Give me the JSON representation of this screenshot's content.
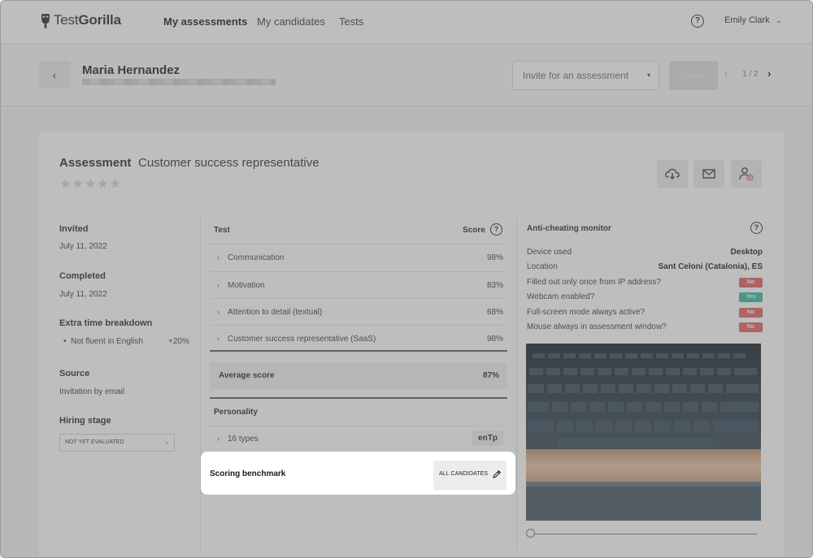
{
  "nav": {
    "logo_prefix": "Test",
    "logo_bold": "Gorilla",
    "links": [
      "My assessments",
      "My candidates",
      "Tests"
    ],
    "help": "?",
    "user_name": "Emily Clark",
    "user_chevron": "⌄"
  },
  "candidate": {
    "back": "‹",
    "name": "Maria Hernandez",
    "invite_placeholder": "Invite for an assessment",
    "invite_caret": "▾",
    "invite_button": "Invite",
    "pager": "1 / 2",
    "prev": "‹",
    "next": "›"
  },
  "assessment": {
    "label": "Assessment",
    "name": "Customer success representative",
    "stars": "★★★★★",
    "rating": 0,
    "actions": [
      "download-cloud-icon",
      "mail-icon",
      "remove-user-icon"
    ]
  },
  "side": {
    "invited_label": "Invited",
    "invited_value": "July 11, 2022",
    "completed_label": "Completed",
    "completed_value": "July 11, 2022",
    "extra_label": "Extra time breakdown",
    "extra_item": "Not fluent in English",
    "extra_value": "+20%",
    "source_label": "Source",
    "source_value": "Invitation by email",
    "stage_label": "Hiring stage",
    "stage_value": "NOT YET EVALUATED",
    "stage_caret": "⌄"
  },
  "tests": {
    "col_test": "Test",
    "col_score": "Score",
    "help": "?",
    "rows": [
      {
        "name": "Communication",
        "score": "98%"
      },
      {
        "name": "Motivation",
        "score": "83%"
      },
      {
        "name": "Attention to detail (textual)",
        "score": "68%"
      },
      {
        "name": "Customer success representative (SaaS)",
        "score": "98%"
      }
    ],
    "chevron": "›",
    "average_label": "Average score",
    "average_value": "87%",
    "personality_label": "Personality",
    "types_label": "16 types",
    "types_value": "enTp",
    "benchmark_label": "Scoring benchmark",
    "benchmark_value": "ALL CANDIDATES"
  },
  "anticheat": {
    "title": "Anti-cheating monitor",
    "help": "?",
    "device_label": "Device used",
    "device_value": "Desktop",
    "location_label": "Location",
    "location_value": "Sant Celoni (Catalonia), ES",
    "checks": [
      {
        "label": "Filled out only once from IP address?",
        "value": "No",
        "status": "no"
      },
      {
        "label": "Webcam enabled?",
        "value": "Yes",
        "status": "yes"
      },
      {
        "label": "Full-screen mode always active?",
        "value": "No",
        "status": "no"
      },
      {
        "label": "Mouse always in assessment window?",
        "value": "No",
        "status": "no"
      }
    ],
    "slider_position": 0
  },
  "colors": {
    "no": "#e05b5b",
    "yes": "#2fb5a4",
    "overlay": "rgba(110,110,110,0.45)"
  }
}
